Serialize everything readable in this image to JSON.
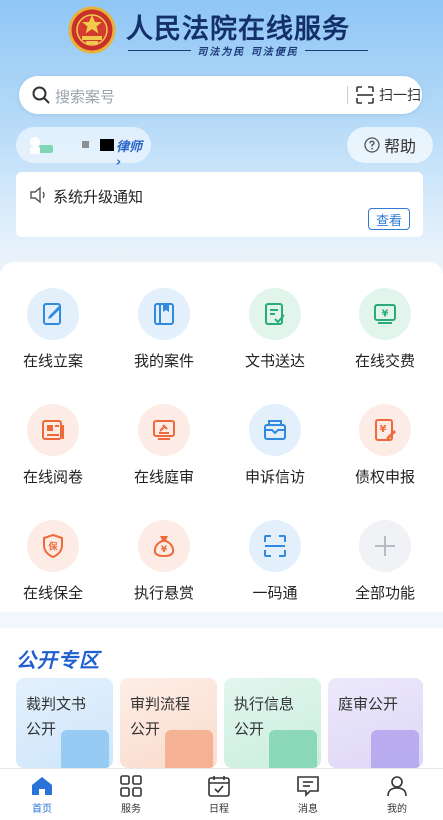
{
  "header": {
    "title": "人民法院在线服务",
    "subtitle": "司法为民  司法便民"
  },
  "search": {
    "placeholder": "搜索案号",
    "scan_label": "扫一扫"
  },
  "user": {
    "role": "律师 ›"
  },
  "help_label": "帮助",
  "notice": {
    "text": "系统升级通知",
    "view_label": "查看"
  },
  "services": [
    {
      "label": "在线立案",
      "icon": "edit-doc-icon"
    },
    {
      "label": "我的案件",
      "icon": "folder-icon"
    },
    {
      "label": "文书送达",
      "icon": "doc-check-icon"
    },
    {
      "label": "在线交费",
      "icon": "payment-icon"
    },
    {
      "label": "在线阅卷",
      "icon": "reading-icon"
    },
    {
      "label": "在线庭审",
      "icon": "court-hearing-icon"
    },
    {
      "label": "申诉信访",
      "icon": "mailbox-icon"
    },
    {
      "label": "债权申报",
      "icon": "claim-icon"
    },
    {
      "label": "在线保全",
      "icon": "shield-icon"
    },
    {
      "label": "执行悬赏",
      "icon": "money-bag-icon"
    },
    {
      "label": "一码通",
      "icon": "qr-scan-icon"
    },
    {
      "label": "全部功能",
      "icon": "plus-icon"
    }
  ],
  "public_zone": {
    "title": "公开专区",
    "cards": [
      {
        "line1": "裁判文书",
        "line2": "公开"
      },
      {
        "line1": "审判流程",
        "line2": "公开"
      },
      {
        "line1": "执行信息",
        "line2": "公开"
      },
      {
        "line1": "庭审公开",
        "line2": ""
      }
    ]
  },
  "tabs": [
    {
      "label": "首页",
      "icon": "home-icon"
    },
    {
      "label": "服务",
      "icon": "grid-icon"
    },
    {
      "label": "日程",
      "icon": "calendar-icon"
    },
    {
      "label": "消息",
      "icon": "message-icon"
    },
    {
      "label": "我的",
      "icon": "profile-icon"
    }
  ],
  "colors": {
    "accent": "#2a73d9",
    "blue_icon": "#2f8ae0",
    "green_icon": "#2bab79",
    "orange_icon": "#ef6a3b"
  }
}
